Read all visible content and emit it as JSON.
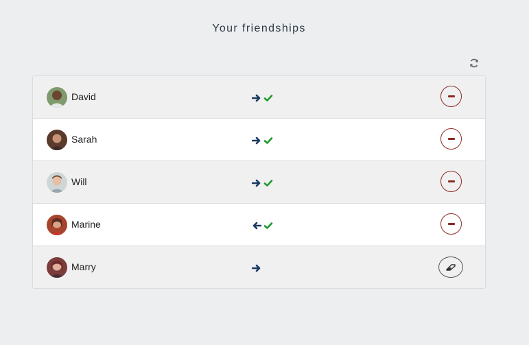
{
  "page": {
    "title": "Your friendships"
  },
  "colors": {
    "arrow": "#1c3a63",
    "check": "#1e9a2a",
    "remove": "#8b2a22"
  },
  "friends": [
    {
      "name": "David",
      "direction": "outgoing",
      "accepted": true,
      "action": "remove"
    },
    {
      "name": "Sarah",
      "direction": "outgoing",
      "accepted": true,
      "action": "remove"
    },
    {
      "name": "Will",
      "direction": "outgoing",
      "accepted": true,
      "action": "remove"
    },
    {
      "name": "Marine",
      "direction": "incoming",
      "accepted": true,
      "action": "remove"
    },
    {
      "name": "Marry",
      "direction": "outgoing",
      "accepted": false,
      "action": "cancel"
    }
  ],
  "icons": {
    "refresh": "refresh-icon",
    "outgoing": "arrow-right-icon",
    "incoming": "arrow-left-icon",
    "accepted": "check-icon",
    "remove": "minus-icon",
    "cancel": "eraser-icon"
  }
}
